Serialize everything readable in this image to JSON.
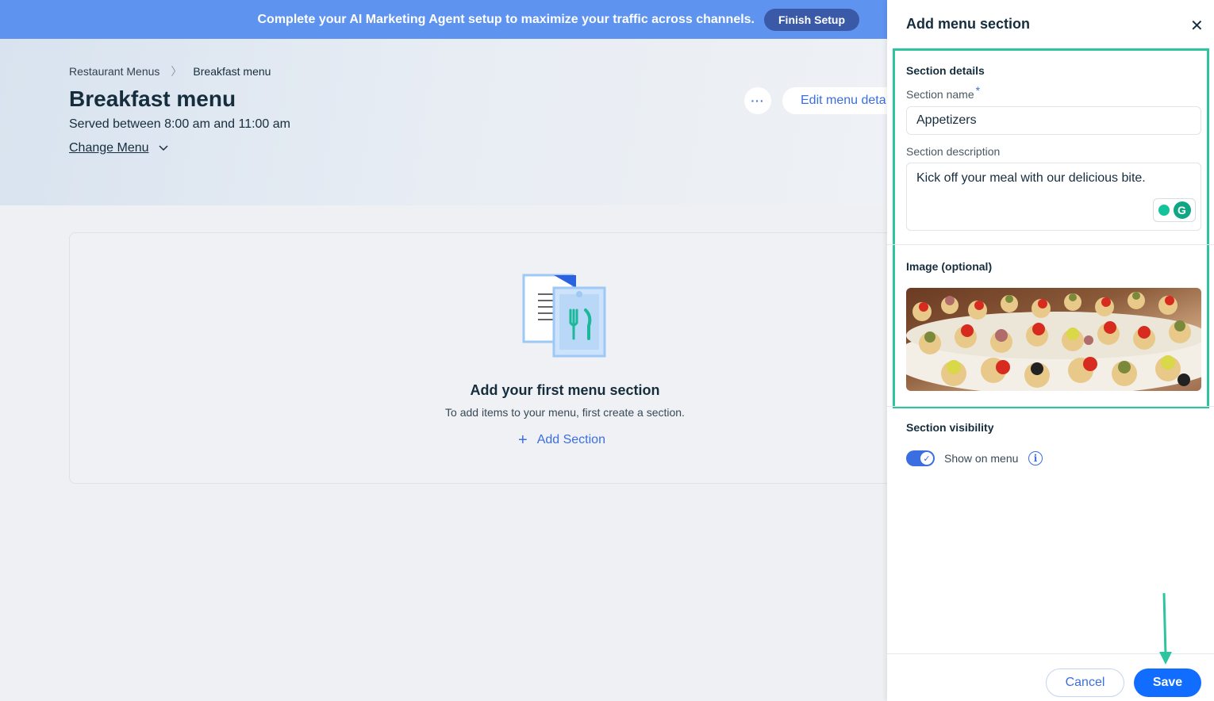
{
  "banner": {
    "text": "Complete your AI Marketing Agent setup to maximize your traffic across channels.",
    "button": "Finish Setup"
  },
  "breadcrumb": {
    "parent": "Restaurant Menus",
    "current": "Breakfast menu"
  },
  "page": {
    "title": "Breakfast menu",
    "subtitle": "Served between 8:00 am and 11:00 am",
    "change_menu": "Change Menu",
    "more_label": "···",
    "edit_button": "Edit menu deta"
  },
  "empty_state": {
    "title": "Add your first menu section",
    "text": "To add items to your menu, first create a section.",
    "add_section": "Add Section"
  },
  "panel": {
    "title": "Add menu section",
    "section_details_heading": "Section details",
    "section_name_label": "Section name",
    "required_mark": "*",
    "section_name_value": "Appetizers",
    "section_description_label": "Section description",
    "section_description_value": "Kick off your meal with our delicious bite.",
    "image_heading": "Image (optional)",
    "visibility_heading": "Section visibility",
    "show_on_menu_label": "Show on menu",
    "show_on_menu_enabled": true,
    "cancel_button": "Cancel",
    "save_button": "Save"
  },
  "colors": {
    "banner": "#5e93f0",
    "accent": "#3b6ee0",
    "save": "#116dff",
    "highlight": "#2ec4a0"
  },
  "icons": [
    "chevron-right-icon",
    "chevron-down-icon",
    "more-icon",
    "plus-icon",
    "close-icon",
    "grammarly-icon",
    "check-icon",
    "info-icon",
    "arrow-down-icon"
  ]
}
